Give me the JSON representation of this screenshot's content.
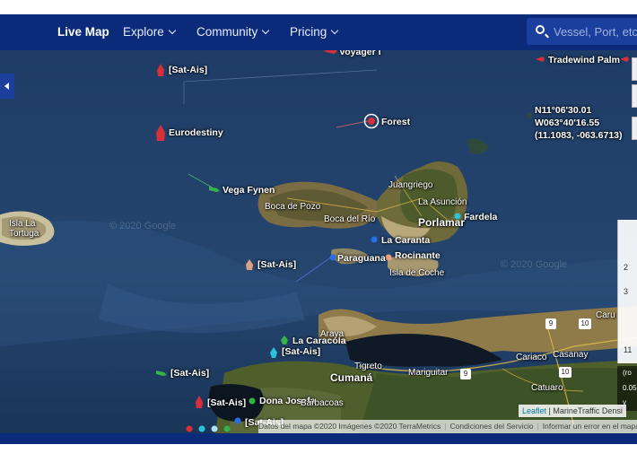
{
  "nav": {
    "live_map": "Live Map",
    "explore": "Explore",
    "community": "Community",
    "pricing": "Pricing"
  },
  "search": {
    "placeholder": "Vessel, Port, etc"
  },
  "vessels": {
    "voyager": "Voyager I",
    "sat_ais_1": "[Sat-Ais]",
    "eurodestiny": "Eurodestiny",
    "forest": "Forest",
    "vega_fynen": "Vega Fynen",
    "fardela": "Fardela",
    "la_caranta": "La Caranta",
    "paraguana": "Paraguana",
    "rocinante": "Rocinante",
    "sat_ais_2": "[Sat-Ais]",
    "la_caracola": "La Caracola",
    "sat_ais_3": "[Sat-Ais]",
    "sat_ais_4": "[Sat-Ais]",
    "sat_ais_5": "[Sat-Ais]",
    "dona_josefa": "Dona Josefa",
    "sat_ais_6": "[Sat-Ais]",
    "tradewind_palm": "Tradewind Palm"
  },
  "places": {
    "isla_la_tortuga": "Isla La\nTortuga",
    "boca_de_pozo": "Boca de Pozo",
    "boca_del_rio": "Boca del Río",
    "juangriego": "Juangriego",
    "la_asuncion": "La Asunción",
    "porlamar": "Porlamar",
    "isla_de_coche": "Isla de Coche",
    "araya": "Araya",
    "cumana": "Cumaná",
    "tigreto": "Tigreto",
    "mariguitar": "Mariguitar",
    "cariaco": "Cariaco",
    "casanay": "Casanay",
    "catuaro": "Catuaro",
    "barbacoas": "Barbacoas",
    "caru": "Caru"
  },
  "roads": {
    "r9a": "9",
    "r10a": "10",
    "r9b": "9",
    "r10b": "10"
  },
  "coords": {
    "lat": "N11°06'30.01",
    "lon": "W063°40'16.55",
    "decimal": "(11.1083, -063.6713)"
  },
  "watermarks": {
    "w1": "© 2020 Google",
    "w2": "© 2020 Google"
  },
  "attribution": {
    "map_data": "Datos del mapa ©2020 Imágenes ©2020 TerraMetrics",
    "terms": "Condiciones del Servicio",
    "report": "Informar un error en el mapa",
    "leaflet": "Leaflet",
    "mt": "| MarineTraffic Densi"
  },
  "right_panel": {
    "v1": "2",
    "v2": "3",
    "v3": "11",
    "v4": "(ro",
    "v5": "0.05",
    "v6": "y"
  },
  "colors": {
    "nav_bg": "#0b2a7a",
    "tanker": "#d8303a",
    "cargo": "#35b24a",
    "passenger": "#2c6de0",
    "tug": "#29c4d8"
  }
}
